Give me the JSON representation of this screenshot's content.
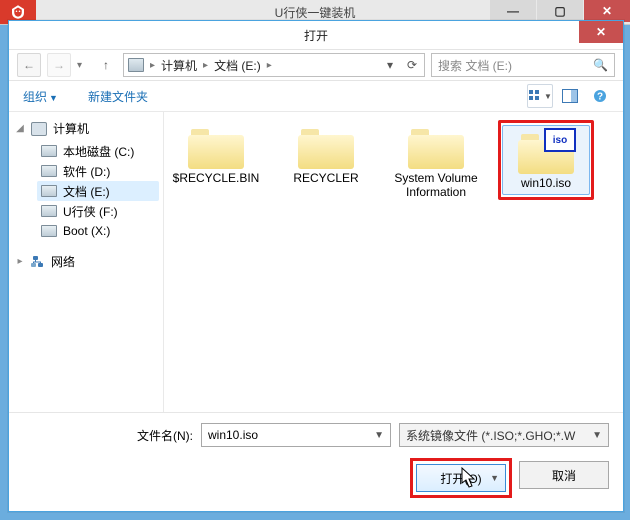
{
  "bg": {
    "title": "U行侠一键装机",
    "min": "—",
    "max": "▢",
    "close": "✕"
  },
  "dialog": {
    "title": "打开",
    "close": "✕"
  },
  "nav": {
    "back": "←",
    "fwd": "→",
    "hist": "▾",
    "up": "↑",
    "refresh": "⟳",
    "dd": "▾"
  },
  "breadcrumb": {
    "root": "计算机",
    "leaf": "文档 (E:)",
    "sep": "▸"
  },
  "search": {
    "placeholder": "搜索 文档 (E:)",
    "icon": "🔍"
  },
  "toolbar": {
    "organize": "组织",
    "newfolder": "新建文件夹"
  },
  "tree": {
    "computer": {
      "label": "计算机",
      "twisty": "◢"
    },
    "drives": [
      {
        "label": "本地磁盘 (C:)"
      },
      {
        "label": "软件 (D:)"
      },
      {
        "label": "文档 (E:)"
      },
      {
        "label": "U行侠 (F:)"
      },
      {
        "label": "Boot (X:)"
      }
    ],
    "network": {
      "label": "网络",
      "twisty": "▸"
    }
  },
  "files": [
    {
      "name": "$RECYCLE.BIN"
    },
    {
      "name": "RECYCLER"
    },
    {
      "name": "System Volume Information"
    },
    {
      "name": "win10.iso"
    }
  ],
  "bottom": {
    "fname_label": "文件名(N):",
    "fname_value": "win10.iso",
    "ftype_value": "系统镜像文件 (*.ISO;*.GHO;*.W",
    "open": "打开(O)",
    "cancel": "取消"
  },
  "iso_badge": "iso"
}
